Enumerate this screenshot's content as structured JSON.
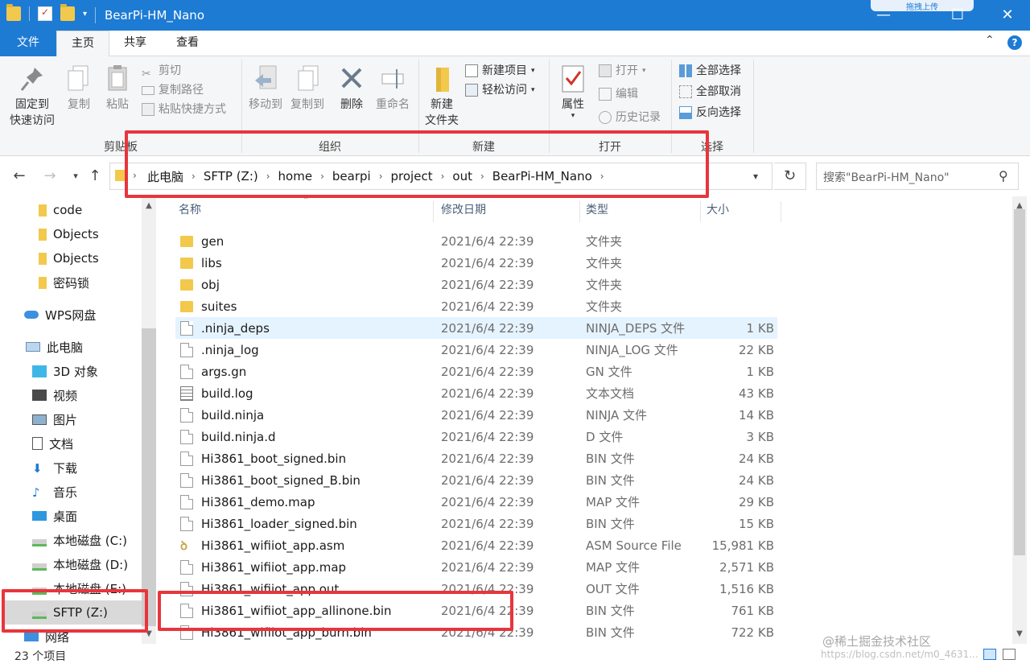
{
  "window": {
    "title": "BearPi-HM_Nano",
    "cloud_badge": "拖拽上传",
    "minimize": "—",
    "maximize": "☐",
    "close": "✕"
  },
  "ribbon_tabs": {
    "file": "文件",
    "home": "主页",
    "share": "共享",
    "view": "查看"
  },
  "ribbon": {
    "clipboard": {
      "pin_line1": "固定到",
      "pin_line2": "快速访问",
      "copy": "复制",
      "paste": "粘贴",
      "cut": "剪切",
      "copy_path": "复制路径",
      "paste_shortcut": "粘贴快捷方式",
      "label": "剪贴板"
    },
    "organize": {
      "move_to": "移动到",
      "copy_to": "复制到",
      "delete": "删除",
      "rename": "重命名",
      "label": "组织"
    },
    "new": {
      "new_folder_line1": "新建",
      "new_folder_line2": "文件夹",
      "new_item": "新建项目",
      "easy_access": "轻松访问",
      "label": "新建"
    },
    "open": {
      "properties": "属性",
      "open": "打开",
      "edit": "编辑",
      "history": "历史记录",
      "label": "打开"
    },
    "select": {
      "select_all": "全部选择",
      "select_none": "全部取消",
      "invert": "反向选择",
      "label": "选择"
    }
  },
  "address": {
    "crumbs": [
      "此电脑",
      "SFTP (Z:)",
      "home",
      "bearpi",
      "project",
      "out",
      "BearPi-HM_Nano"
    ],
    "search_placeholder": "搜索\"BearPi-HM_Nano\""
  },
  "nav": {
    "items": [
      {
        "label": "code",
        "icon": "folder-icon"
      },
      {
        "label": "Objects",
        "icon": "folder-icon"
      },
      {
        "label": "Objects",
        "icon": "folder-icon"
      },
      {
        "label": "密码锁",
        "icon": "folder-icon"
      },
      {
        "label": "WPS网盘",
        "icon": "cloud-icon"
      },
      {
        "label": "此电脑",
        "icon": "computer-icon"
      },
      {
        "label": "3D 对象",
        "icon": "cube-icon"
      },
      {
        "label": "视频",
        "icon": "film-icon"
      },
      {
        "label": "图片",
        "icon": "picture-icon"
      },
      {
        "label": "文档",
        "icon": "document-icon"
      },
      {
        "label": "下载",
        "icon": "download-icon"
      },
      {
        "label": "音乐",
        "icon": "music-icon"
      },
      {
        "label": "桌面",
        "icon": "desktop-icon"
      },
      {
        "label": "本地磁盘 (C:)",
        "icon": "drive-icon"
      },
      {
        "label": "本地磁盘 (D:)",
        "icon": "drive-icon"
      },
      {
        "label": "本地磁盘 (E:)",
        "icon": "drive-icon"
      },
      {
        "label": "SFTP (Z:)",
        "icon": "network-drive-icon"
      },
      {
        "label": "网络",
        "icon": "network-icon"
      }
    ]
  },
  "columns": {
    "name": "名称",
    "date": "修改日期",
    "type": "类型",
    "size": "大小"
  },
  "files": [
    {
      "name": "gen",
      "date": "2021/6/4 22:39",
      "type": "文件夹",
      "size": "",
      "icon": "folder"
    },
    {
      "name": "libs",
      "date": "2021/6/4 22:39",
      "type": "文件夹",
      "size": "",
      "icon": "folder"
    },
    {
      "name": "obj",
      "date": "2021/6/4 22:39",
      "type": "文件夹",
      "size": "",
      "icon": "folder"
    },
    {
      "name": "suites",
      "date": "2021/6/4 22:39",
      "type": "文件夹",
      "size": "",
      "icon": "folder"
    },
    {
      "name": ".ninja_deps",
      "date": "2021/6/4 22:39",
      "type": "NINJA_DEPS 文件",
      "size": "1 KB",
      "icon": "file"
    },
    {
      "name": ".ninja_log",
      "date": "2021/6/4 22:39",
      "type": "NINJA_LOG 文件",
      "size": "22 KB",
      "icon": "file"
    },
    {
      "name": "args.gn",
      "date": "2021/6/4 22:39",
      "type": "GN 文件",
      "size": "1 KB",
      "icon": "file"
    },
    {
      "name": "build.log",
      "date": "2021/6/4 22:39",
      "type": "文本文档",
      "size": "43 KB",
      "icon": "txt"
    },
    {
      "name": "build.ninja",
      "date": "2021/6/4 22:39",
      "type": "NINJA 文件",
      "size": "14 KB",
      "icon": "file"
    },
    {
      "name": "build.ninja.d",
      "date": "2021/6/4 22:39",
      "type": "D 文件",
      "size": "3 KB",
      "icon": "file"
    },
    {
      "name": "Hi3861_boot_signed.bin",
      "date": "2021/6/4 22:39",
      "type": "BIN 文件",
      "size": "24 KB",
      "icon": "file"
    },
    {
      "name": "Hi3861_boot_signed_B.bin",
      "date": "2021/6/4 22:39",
      "type": "BIN 文件",
      "size": "24 KB",
      "icon": "file"
    },
    {
      "name": "Hi3861_demo.map",
      "date": "2021/6/4 22:39",
      "type": "MAP 文件",
      "size": "29 KB",
      "icon": "file"
    },
    {
      "name": "Hi3861_loader_signed.bin",
      "date": "2021/6/4 22:39",
      "type": "BIN 文件",
      "size": "15 KB",
      "icon": "file"
    },
    {
      "name": "Hi3861_wifiiot_app.asm",
      "date": "2021/6/4 22:39",
      "type": "ASM Source File",
      "size": "15,981 KB",
      "icon": "asm"
    },
    {
      "name": "Hi3861_wifiiot_app.map",
      "date": "2021/6/4 22:39",
      "type": "MAP 文件",
      "size": "2,571 KB",
      "icon": "file"
    },
    {
      "name": "Hi3861_wifiiot_app.out",
      "date": "2021/6/4 22:39",
      "type": "OUT 文件",
      "size": "1,516 KB",
      "icon": "file"
    },
    {
      "name": "Hi3861_wifiiot_app_allinone.bin",
      "date": "2021/6/4 22:39",
      "type": "BIN 文件",
      "size": "761 KB",
      "icon": "file"
    },
    {
      "name": "Hi3861_wifiiot_app_burn.bin",
      "date": "2021/6/4 22:39",
      "type": "BIN 文件",
      "size": "722 KB",
      "icon": "file"
    }
  ],
  "status": {
    "count": "23 个项目",
    "watermark": "@稀土掘金技术社区",
    "watermark_url": "https://blog.csdn.net/m0_4631..."
  },
  "colors": {
    "accent": "#1d7bd4",
    "highlight": "#e8353d",
    "selected_row": "#e5f3ff"
  }
}
